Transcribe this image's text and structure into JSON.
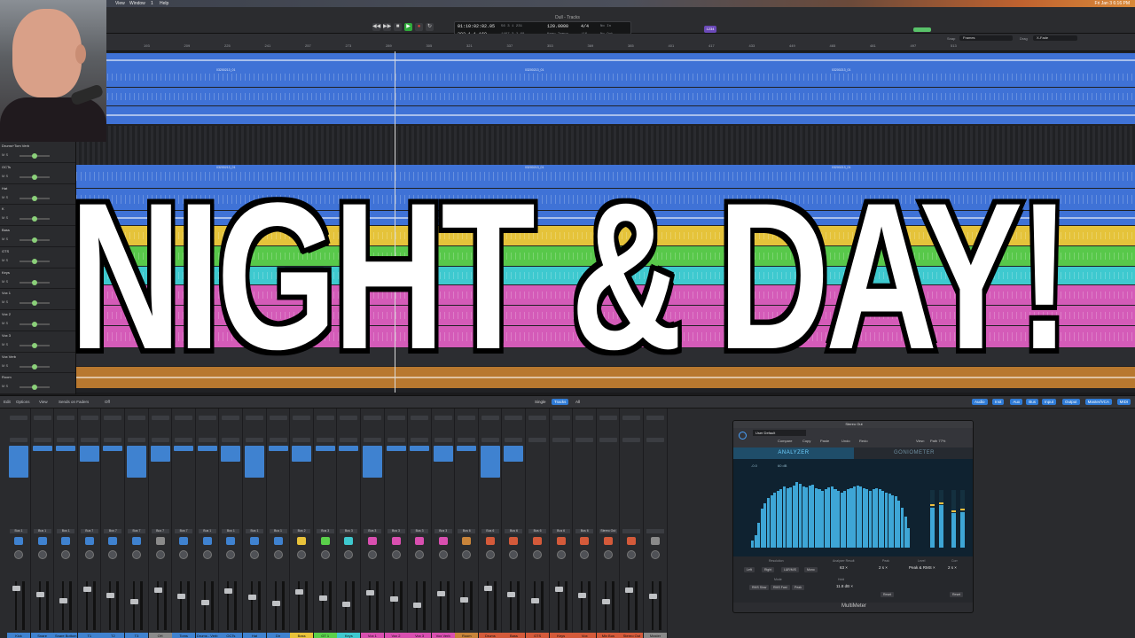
{
  "menubar": {
    "items": [
      "View",
      "Window",
      "1",
      "Help"
    ],
    "clock": "Fri Jan 3 6:16 PM"
  },
  "controlbar": {
    "window_title": "Dull - Tracks",
    "lcd": {
      "time": "01:10:02:02.05",
      "bars": "302  1  1  160",
      "pos1": "56  3  1  231",
      "pos2": "1467  3  2  68",
      "tempo": "120.0000",
      "tempo_label": "Keep Tempo",
      "sig": "4/4",
      "div": "/16",
      "in": "No In",
      "out": "No Out"
    },
    "badge": "1234"
  },
  "ruler": {
    "ticks": [
      "193",
      "209",
      "225",
      "241",
      "257",
      "273",
      "289",
      "305",
      "321",
      "337",
      "353",
      "369",
      "385",
      "401",
      "417",
      "433",
      "449",
      "465",
      "481",
      "497",
      "513"
    ],
    "snap_label": "Snap",
    "snap_value": "Frames",
    "drag_label": "Drag",
    "drag_value": "X-Fade"
  },
  "track_headers": [
    {
      "name": "Drums+Tom Verb"
    },
    {
      "name": "OCTs"
    },
    {
      "name": "Hat"
    },
    {
      "name": "K"
    },
    {
      "name": "Bass"
    },
    {
      "name": "GTS"
    },
    {
      "name": "Keys"
    },
    {
      "name": "Vox 1"
    },
    {
      "name": "Vox 2"
    },
    {
      "name": "Vox 3"
    },
    {
      "name": "Vox Verb"
    },
    {
      "name": "Room"
    }
  ],
  "region_label": "03200213_01",
  "mixer": {
    "header": {
      "edit": "Edit",
      "options": "Options",
      "view": "View",
      "sends": "Sends on Faders",
      "off": "Off",
      "single": "Single",
      "tracks": "Tracks",
      "all": "All",
      "filters": [
        "Audio",
        "Inst",
        "Aux",
        "Bus",
        "Input",
        "Output",
        "Master/VCA",
        "MIDI"
      ]
    },
    "strips": [
      {
        "name": "Kick",
        "color": "#3f82d0",
        "route": "Bus 1"
      },
      {
        "name": "Snare",
        "color": "#3f82d0",
        "route": "Bus 1"
      },
      {
        "name": "Snare Bottom",
        "color": "#3f82d0",
        "route": "Bus 1"
      },
      {
        "name": "T1",
        "color": "#3f82d0",
        "route": "Bus 7"
      },
      {
        "name": "T2",
        "color": "#3f82d0",
        "route": "Bus 7"
      },
      {
        "name": "T3",
        "color": "#3f82d0",
        "route": "Bus 7"
      },
      {
        "name": "OH",
        "color": "#8a8a8a",
        "route": "Bus 7"
      },
      {
        "name": "Toms",
        "color": "#3f82d0",
        "route": "Bus 7"
      },
      {
        "name": "Drums - Verb",
        "color": "#3f82d0",
        "route": "Bus 1"
      },
      {
        "name": "OCTs",
        "color": "#3f82d0",
        "route": "Bus 1"
      },
      {
        "name": "Hat",
        "color": "#3f82d0",
        "route": "Bus 1"
      },
      {
        "name": "Dir",
        "color": "#3f82d0",
        "route": "Bus 1"
      },
      {
        "name": "Bass",
        "color": "#e8c23a",
        "route": "Bus 2"
      },
      {
        "name": "GT 1",
        "color": "#5ad04a",
        "route": "Bus 3"
      },
      {
        "name": "Keys",
        "color": "#3ec9cf",
        "route": "Bus 3"
      },
      {
        "name": "Vox 1",
        "color": "#d94fb0",
        "route": "Bus 3"
      },
      {
        "name": "Vox 2",
        "color": "#d94fb0",
        "route": "Bus 3"
      },
      {
        "name": "Vox 3",
        "color": "#d94fb0",
        "route": "Bus 3"
      },
      {
        "name": "Vox Verb",
        "color": "#d94fb0",
        "route": "Bus 3"
      },
      {
        "name": "Room",
        "color": "#c8843a",
        "route": "Bus 6"
      },
      {
        "name": "Drums",
        "color": "#d45a3a",
        "route": "Bus 6"
      },
      {
        "name": "Bass",
        "color": "#d45a3a",
        "route": "Bus 6"
      },
      {
        "name": "GTS",
        "color": "#d45a3a",
        "route": "Bus 6"
      },
      {
        "name": "Keys",
        "color": "#d45a3a",
        "route": "Bus 6"
      },
      {
        "name": "Vox",
        "color": "#d45a3a",
        "route": "Bus 6"
      },
      {
        "name": "Mix Bus",
        "color": "#d45a3a",
        "route": "Stereo Out"
      },
      {
        "name": "Stereo Out",
        "color": "#d45a3a",
        "route": ""
      },
      {
        "name": "Master",
        "color": "#8a8a8a",
        "route": ""
      }
    ]
  },
  "plugin": {
    "title": "Stereo Out",
    "preset": "User Default",
    "buttons": [
      "Compare",
      "Copy",
      "Paste",
      "Undo",
      "Redo"
    ],
    "view_label": "View:",
    "view_value": "Path 77%",
    "tabs": {
      "analyzer": "ANALYZER",
      "goniometer": "GONIOMETER"
    },
    "readouts": {
      "top": "-0.0",
      "range": "60 dB"
    },
    "controls": {
      "resolution_label": "Resolution",
      "resolution_values": [
        "Left",
        "Right",
        "L&R/M/S",
        "Mono"
      ],
      "analyzer_label": "Analyzer Result",
      "analyzer_value": "63 ×",
      "mode_label": "Mode",
      "mode_values": [
        "RMS Slow",
        "RMS Fast",
        "Peak"
      ],
      "hold_label": "Hold",
      "hold_value": "2 s ×",
      "reset_label": "Reset",
      "level_label": "Level",
      "level_value": "Peak & RMS ×",
      "peak_label": "Peak",
      "peak_value": "11.8 dB ×",
      "correlation_label": "Corr",
      "correlation_value": "2 s ×"
    },
    "footer": "MultiMeter"
  },
  "headline": "NIGHT & DAY!",
  "colors": {
    "blue_region": "#3f72d6",
    "yellow_region": "#e5c33a",
    "green_region": "#58c84a",
    "cyan_region": "#3ec9cf",
    "pink_region": "#d45bb8",
    "brown_region": "#b8782f",
    "analyzer_bar": "#3ea6d6"
  },
  "analyzer_levels": [
    0.1,
    0.18,
    0.35,
    0.55,
    0.62,
    0.7,
    0.74,
    0.78,
    0.8,
    0.82,
    0.86,
    0.84,
    0.85,
    0.88,
    0.92,
    0.9,
    0.86,
    0.85,
    0.87,
    0.89,
    0.84,
    0.82,
    0.8,
    0.83,
    0.85,
    0.86,
    0.82,
    0.8,
    0.78,
    0.8,
    0.82,
    0.84,
    0.86,
    0.88,
    0.86,
    0.84,
    0.82,
    0.8,
    0.82,
    0.84,
    0.83,
    0.8,
    0.78,
    0.76,
    0.74,
    0.72,
    0.66,
    0.56,
    0.44,
    0.28
  ]
}
